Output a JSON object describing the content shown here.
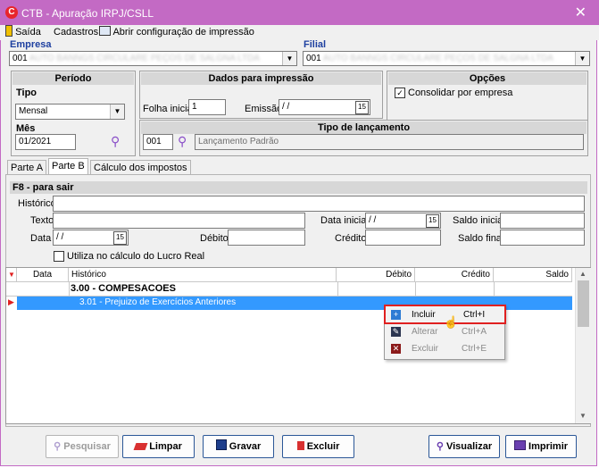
{
  "window": {
    "title": "CTB - Apuração IRPJ/CSLL",
    "close_glyph": "✕",
    "app_icon_letter": "C"
  },
  "menu": {
    "exit": "Saída",
    "register": "Cadastros",
    "print_config": "Abrir configuração de impressão"
  },
  "company": {
    "label": "Empresa",
    "value": "001"
  },
  "branch": {
    "label": "Filial",
    "value": "001"
  },
  "periodo": {
    "title": "Período",
    "type_label": "Tipo",
    "type_value": "Mensal",
    "month_label": "Mês",
    "month_value": "01/2021"
  },
  "print": {
    "title": "Dados para impressão",
    "first_sheet_label": "Folha inicial",
    "first_sheet_value": "1",
    "emission_label": "Emissão",
    "emission_value": " / /"
  },
  "options": {
    "title": "Opções",
    "consolidate_label": "Consolidar por empresa",
    "consolidate_checked": true
  },
  "entry_type": {
    "title": "Tipo de lançamento",
    "code": "001",
    "description": "Lançamento Padrão"
  },
  "tabs": [
    "Parte A",
    "Parte B",
    "Cálculo dos impostos"
  ],
  "part_b": {
    "hint": "F8 - para sair",
    "historico_label": "Histórico",
    "texto_label": "Texto",
    "data_inicial_label": "Data inicial",
    "data_inicial_value": " / /",
    "saldo_inicial_label": "Saldo inicial",
    "data_label": "Data",
    "data_value": " / /",
    "debito_label": "Débito",
    "credito_label": "Crédito",
    "saldo_final_label": "Saldo final",
    "lucro_real_label": "Utiliza no cálculo do Lucro Real"
  },
  "grid": {
    "columns": [
      "Data",
      "Histórico",
      "Débito",
      "Crédito",
      "Saldo"
    ],
    "rows": [
      {
        "historico": "3.00 - COMPESACOES",
        "bold": true,
        "selected": false
      },
      {
        "historico": "3.01 - Prejuizo de Exercícios Anteriores",
        "bold": false,
        "selected": true
      }
    ]
  },
  "context_menu": [
    {
      "label": "Incluir",
      "shortcut": "Ctrl+I",
      "enabled": true,
      "highlighted": true
    },
    {
      "label": "Alterar",
      "shortcut": "Ctrl+A",
      "enabled": false
    },
    {
      "label": "Excluir",
      "shortcut": "Ctrl+E",
      "enabled": false
    }
  ],
  "buttons": {
    "pesquisar": "Pesquisar",
    "limpar": "Limpar",
    "gravar": "Gravar",
    "excluir": "Excluir",
    "visualizar": "Visualizar",
    "imprimir": "Imprimir"
  },
  "colors": {
    "titlebar": "#c36ac4",
    "selection": "#3399ff",
    "highlight_border": "#e02020",
    "label_blue": "#1e40a0"
  }
}
